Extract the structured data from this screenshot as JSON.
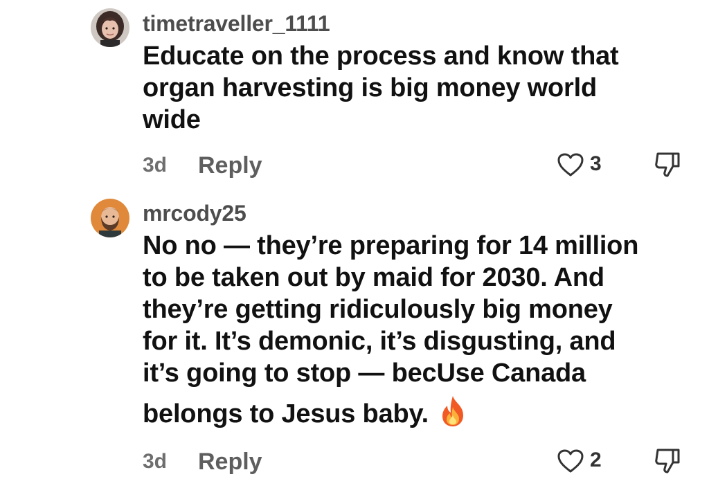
{
  "comments": [
    {
      "username": "timetraveller_1111",
      "avatar_icon": "avatar-woman-dark-hair",
      "text_lines": [
        "Educate on the process and know that",
        "organ harvesting is big money world",
        "wide"
      ],
      "time": "3d",
      "reply_label": "Reply",
      "like_count": "3",
      "like_icon": "heart-outline-icon",
      "dislike_icon": "thumbs-down-icon"
    },
    {
      "username": "mrcody25",
      "avatar_icon": "avatar-man-beard-orange-bg",
      "text_lines": [
        "No no — they’re preparing for 14 million",
        "to be taken out by maid for 2030. And",
        "they’re getting ridiculously big money",
        "for it. It’s demonic, it’s disgusting, and",
        "it’s going to stop — becUse Canada",
        "belongs to Jesus baby."
      ],
      "emoji": "🔥",
      "emoji_icon": "fire-emoji-icon",
      "time": "3d",
      "reply_label": "Reply",
      "like_count": "2",
      "like_icon": "heart-outline-icon",
      "dislike_icon": "thumbs-down-icon"
    }
  ],
  "colors": {
    "text": "#111111",
    "username": "#4d4d4d",
    "meta": "#6e6e6e",
    "avatar2_bg": "#e0893a"
  }
}
